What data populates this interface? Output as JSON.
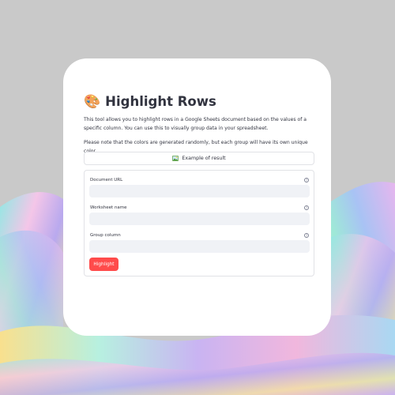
{
  "app": {
    "title_emoji": "🎨",
    "title": "Highlight Rows",
    "description": "This tool allows you to highlight rows in a Google Sheets document based on the values of a specific column. You can use this to visually group data in your spreadsheet.",
    "note": "Please note that the colors are generated randomly, but each group will have its own unique color."
  },
  "expander": {
    "icon": "picture-icon",
    "label": "Example of result"
  },
  "form": {
    "fields": [
      {
        "label": "Document URL",
        "value": "",
        "placeholder": ""
      },
      {
        "label": "Worksheet name",
        "value": "",
        "placeholder": ""
      },
      {
        "label": "Group column",
        "value": "",
        "placeholder": ""
      }
    ],
    "help_icon": "question-circle-icon",
    "submit_label": "Highlight"
  },
  "colors": {
    "page_background": "#c9c9c9",
    "card_background": "#ffffff",
    "text": "#31333f",
    "input_background": "#f0f2f6",
    "primary_button": "#ff4b4b",
    "border": "#e1e2e6"
  }
}
